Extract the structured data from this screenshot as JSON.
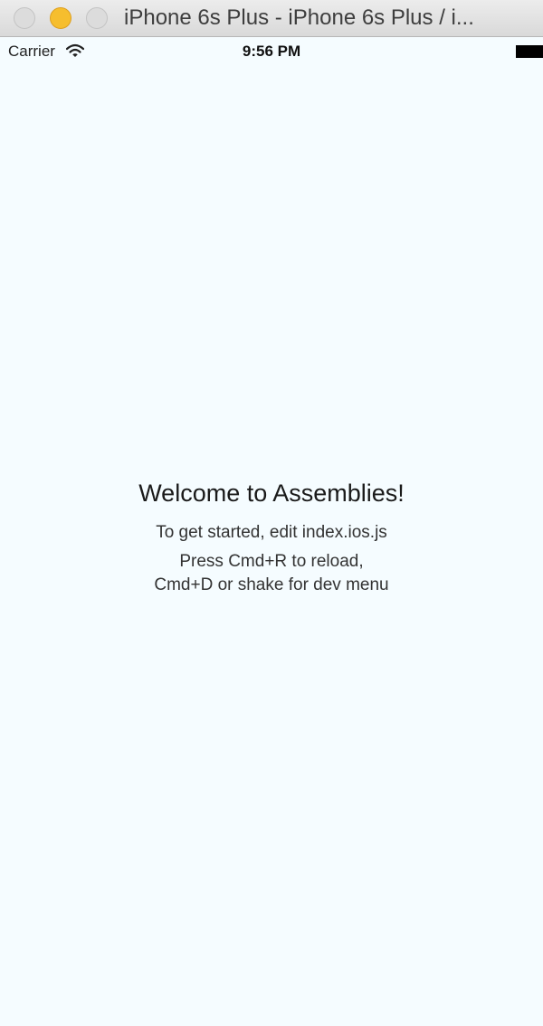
{
  "window": {
    "title": "iPhone 6s Plus - iPhone 6s Plus / i..."
  },
  "status_bar": {
    "carrier": "Carrier",
    "time": "9:56 PM",
    "icons": [
      "wifi-icon",
      "battery-icon"
    ]
  },
  "app": {
    "welcome": "Welcome to Assemblies!",
    "instructions_line1": "To get started, edit index.ios.js",
    "instructions_line2a": "Press Cmd+R to reload,",
    "instructions_line2b": "Cmd+D or shake for dev menu"
  },
  "colors": {
    "background": "#f5fcff",
    "minimize_button": "#f6be2e"
  }
}
